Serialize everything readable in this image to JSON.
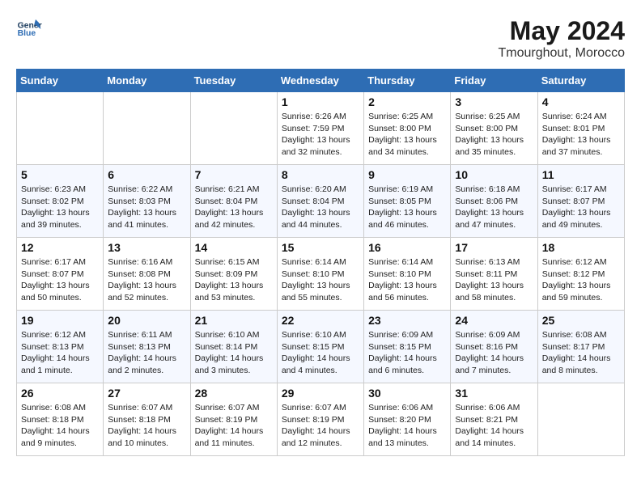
{
  "header": {
    "logo_line1": "General",
    "logo_line2": "Blue",
    "month_year": "May 2024",
    "location": "Tmourghout, Morocco"
  },
  "weekdays": [
    "Sunday",
    "Monday",
    "Tuesday",
    "Wednesday",
    "Thursday",
    "Friday",
    "Saturday"
  ],
  "weeks": [
    [
      {
        "day": "",
        "info": ""
      },
      {
        "day": "",
        "info": ""
      },
      {
        "day": "",
        "info": ""
      },
      {
        "day": "1",
        "info": "Sunrise: 6:26 AM\nSunset: 7:59 PM\nDaylight: 13 hours\nand 32 minutes."
      },
      {
        "day": "2",
        "info": "Sunrise: 6:25 AM\nSunset: 8:00 PM\nDaylight: 13 hours\nand 34 minutes."
      },
      {
        "day": "3",
        "info": "Sunrise: 6:25 AM\nSunset: 8:00 PM\nDaylight: 13 hours\nand 35 minutes."
      },
      {
        "day": "4",
        "info": "Sunrise: 6:24 AM\nSunset: 8:01 PM\nDaylight: 13 hours\nand 37 minutes."
      }
    ],
    [
      {
        "day": "5",
        "info": "Sunrise: 6:23 AM\nSunset: 8:02 PM\nDaylight: 13 hours\nand 39 minutes."
      },
      {
        "day": "6",
        "info": "Sunrise: 6:22 AM\nSunset: 8:03 PM\nDaylight: 13 hours\nand 41 minutes."
      },
      {
        "day": "7",
        "info": "Sunrise: 6:21 AM\nSunset: 8:04 PM\nDaylight: 13 hours\nand 42 minutes."
      },
      {
        "day": "8",
        "info": "Sunrise: 6:20 AM\nSunset: 8:04 PM\nDaylight: 13 hours\nand 44 minutes."
      },
      {
        "day": "9",
        "info": "Sunrise: 6:19 AM\nSunset: 8:05 PM\nDaylight: 13 hours\nand 46 minutes."
      },
      {
        "day": "10",
        "info": "Sunrise: 6:18 AM\nSunset: 8:06 PM\nDaylight: 13 hours\nand 47 minutes."
      },
      {
        "day": "11",
        "info": "Sunrise: 6:17 AM\nSunset: 8:07 PM\nDaylight: 13 hours\nand 49 minutes."
      }
    ],
    [
      {
        "day": "12",
        "info": "Sunrise: 6:17 AM\nSunset: 8:07 PM\nDaylight: 13 hours\nand 50 minutes."
      },
      {
        "day": "13",
        "info": "Sunrise: 6:16 AM\nSunset: 8:08 PM\nDaylight: 13 hours\nand 52 minutes."
      },
      {
        "day": "14",
        "info": "Sunrise: 6:15 AM\nSunset: 8:09 PM\nDaylight: 13 hours\nand 53 minutes."
      },
      {
        "day": "15",
        "info": "Sunrise: 6:14 AM\nSunset: 8:10 PM\nDaylight: 13 hours\nand 55 minutes."
      },
      {
        "day": "16",
        "info": "Sunrise: 6:14 AM\nSunset: 8:10 PM\nDaylight: 13 hours\nand 56 minutes."
      },
      {
        "day": "17",
        "info": "Sunrise: 6:13 AM\nSunset: 8:11 PM\nDaylight: 13 hours\nand 58 minutes."
      },
      {
        "day": "18",
        "info": "Sunrise: 6:12 AM\nSunset: 8:12 PM\nDaylight: 13 hours\nand 59 minutes."
      }
    ],
    [
      {
        "day": "19",
        "info": "Sunrise: 6:12 AM\nSunset: 8:13 PM\nDaylight: 14 hours\nand 1 minute."
      },
      {
        "day": "20",
        "info": "Sunrise: 6:11 AM\nSunset: 8:13 PM\nDaylight: 14 hours\nand 2 minutes."
      },
      {
        "day": "21",
        "info": "Sunrise: 6:10 AM\nSunset: 8:14 PM\nDaylight: 14 hours\nand 3 minutes."
      },
      {
        "day": "22",
        "info": "Sunrise: 6:10 AM\nSunset: 8:15 PM\nDaylight: 14 hours\nand 4 minutes."
      },
      {
        "day": "23",
        "info": "Sunrise: 6:09 AM\nSunset: 8:15 PM\nDaylight: 14 hours\nand 6 minutes."
      },
      {
        "day": "24",
        "info": "Sunrise: 6:09 AM\nSunset: 8:16 PM\nDaylight: 14 hours\nand 7 minutes."
      },
      {
        "day": "25",
        "info": "Sunrise: 6:08 AM\nSunset: 8:17 PM\nDaylight: 14 hours\nand 8 minutes."
      }
    ],
    [
      {
        "day": "26",
        "info": "Sunrise: 6:08 AM\nSunset: 8:18 PM\nDaylight: 14 hours\nand 9 minutes."
      },
      {
        "day": "27",
        "info": "Sunrise: 6:07 AM\nSunset: 8:18 PM\nDaylight: 14 hours\nand 10 minutes."
      },
      {
        "day": "28",
        "info": "Sunrise: 6:07 AM\nSunset: 8:19 PM\nDaylight: 14 hours\nand 11 minutes."
      },
      {
        "day": "29",
        "info": "Sunrise: 6:07 AM\nSunset: 8:19 PM\nDaylight: 14 hours\nand 12 minutes."
      },
      {
        "day": "30",
        "info": "Sunrise: 6:06 AM\nSunset: 8:20 PM\nDaylight: 14 hours\nand 13 minutes."
      },
      {
        "day": "31",
        "info": "Sunrise: 6:06 AM\nSunset: 8:21 PM\nDaylight: 14 hours\nand 14 minutes."
      },
      {
        "day": "",
        "info": ""
      }
    ]
  ]
}
